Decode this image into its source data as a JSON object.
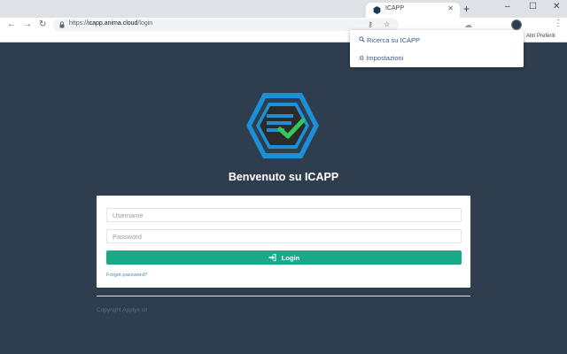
{
  "browser": {
    "tab": {
      "title": "ICAPP",
      "close_icon": "close-icon",
      "favicon": "icapp-favicon"
    },
    "new_tab_label": "+",
    "window_controls": {
      "minimize": "–",
      "maximize": "☐",
      "close": "✕"
    },
    "url": {
      "prefix": "https://",
      "host": "icapp.anima.cloud",
      "path": "/login"
    },
    "bookmarks": {
      "other_favorites": "Altri Preferiti"
    }
  },
  "popup": {
    "items": [
      {
        "label": "Ricerca su ICAPP",
        "icon": "search-icon"
      },
      {
        "label": "Impostazioni",
        "icon": "cogs-icon"
      }
    ]
  },
  "page": {
    "heading": "Benvenuto su ICAPP",
    "form": {
      "username_placeholder": "Username",
      "password_placeholder": "Password",
      "login_label": "Login",
      "forgot_label": "Forgot password?"
    },
    "copyright": "Copyright Applyx srl"
  },
  "colors": {
    "page_bg": "#2e3e4f",
    "accent": "#1aaa8a",
    "logo_blue": "#1c8fd6",
    "check_green": "#34c759",
    "link": "#3c8dbc"
  }
}
